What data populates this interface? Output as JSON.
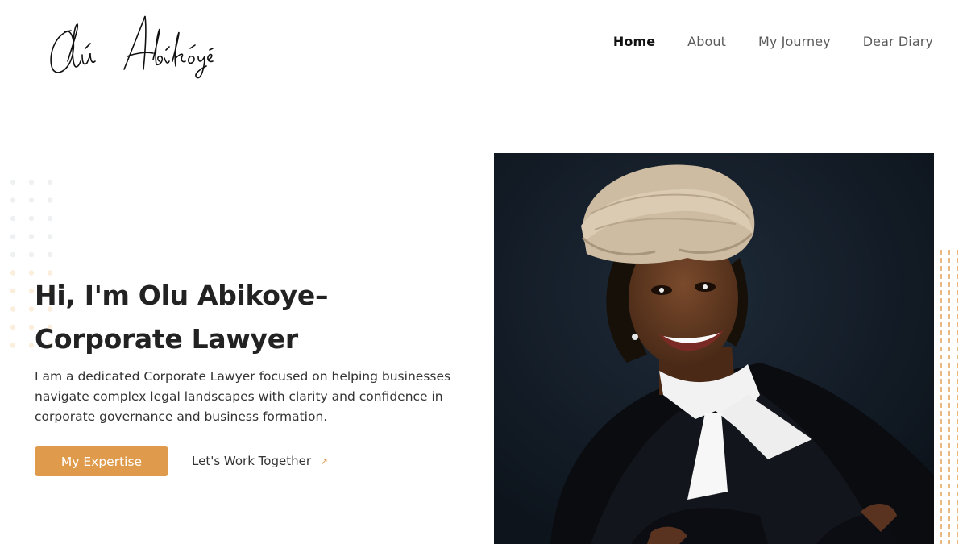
{
  "brand": {
    "logo_text": "Olú Abíkóyè"
  },
  "nav": {
    "items": [
      {
        "label": "Home",
        "active": true
      },
      {
        "label": "About",
        "active": false
      },
      {
        "label": "My Journey",
        "active": false
      },
      {
        "label": "Dear Diary",
        "active": false
      }
    ]
  },
  "hero": {
    "title_line1": "Hi, I'm Olu Abikoye–",
    "title_line2": "Corporate Lawyer",
    "description": "I am a dedicated Corporate Lawyer focused on helping businesses navigate complex legal landscapes with clarity and confidence in corporate governance and business formation.",
    "primary_cta": "My Expertise",
    "secondary_cta": "Let's Work Together",
    "secondary_icon": "arrow-up-right-icon"
  },
  "colors": {
    "accent": "#e09a4b",
    "text_dark": "#222222",
    "nav_inactive": "#5b5b5b",
    "photo_bg": "#131c27"
  }
}
